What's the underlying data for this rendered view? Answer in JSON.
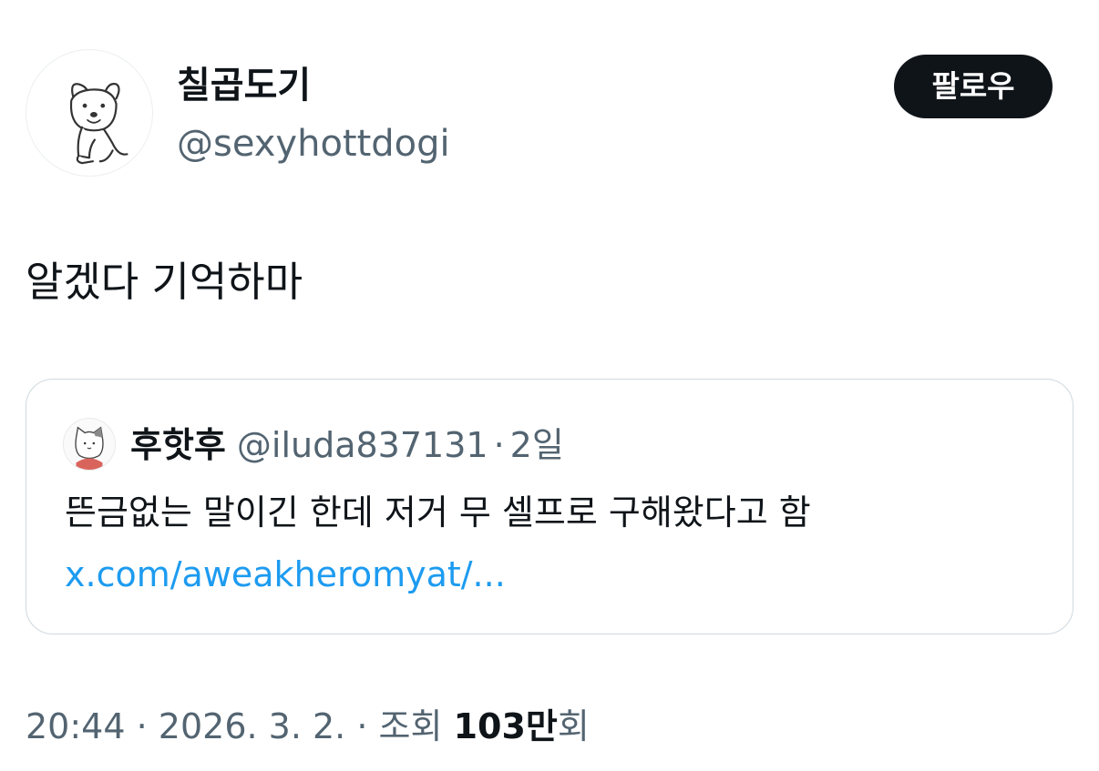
{
  "author": {
    "display_name": "칠곱도기",
    "handle": "@sexyhottdogi",
    "avatar_icon": "dog-illustration-avatar"
  },
  "follow_button": {
    "label": "팔로우"
  },
  "tweet": {
    "text": "알겠다 기억하마"
  },
  "quote": {
    "display_name": "후핫후",
    "handle": "@iluda837131",
    "separator": "·",
    "time": "2일",
    "text": "뜬금없는 말이긴 한데 저거 무 셀프로 구해왔다고 함",
    "link": "x.com/aweakheromyat/...",
    "avatar_icon": "cat-illustration-avatar"
  },
  "meta": {
    "time": "20:44",
    "separator": "·",
    "date": "2026. 3. 2.",
    "views_prefix": "조회",
    "views_count": "103만",
    "views_suffix": "회"
  },
  "colors": {
    "text_primary": "#0f1419",
    "text_secondary": "#536471",
    "link": "#1d9bf0",
    "border": "#cfd9de",
    "button_bg": "#0f1419",
    "button_text": "#ffffff"
  }
}
